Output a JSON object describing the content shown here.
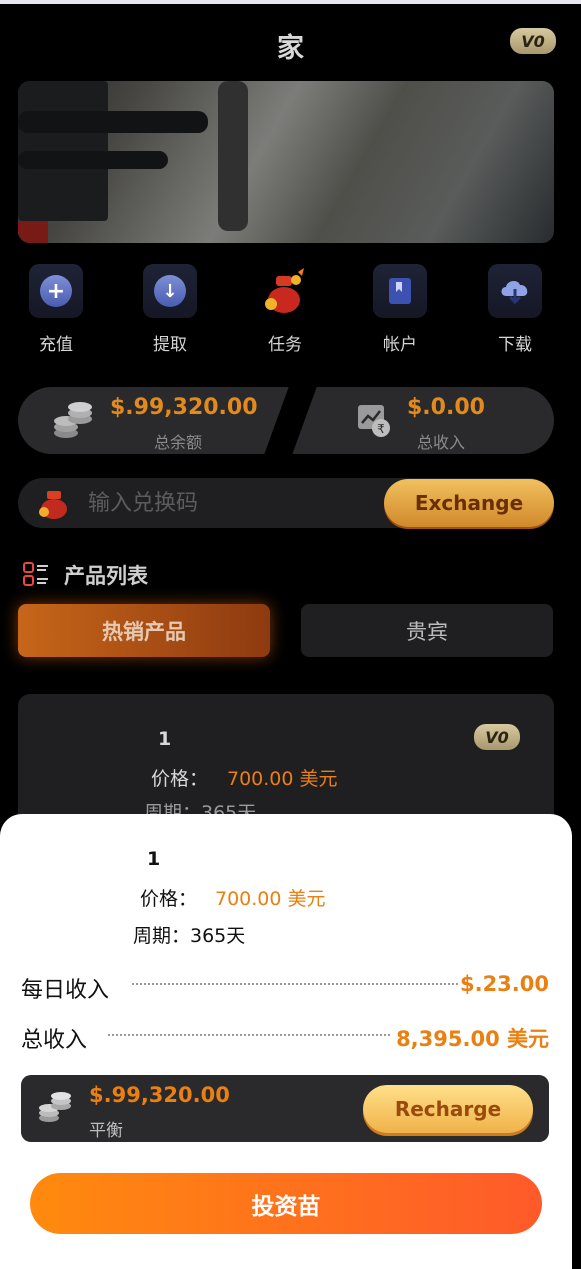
{
  "header": {
    "title": "家",
    "vip_badge": "V0"
  },
  "nav": {
    "items": [
      {
        "label": "充值",
        "icon": "plus-circle-icon"
      },
      {
        "label": "提取",
        "icon": "arrow-down-circle-icon"
      },
      {
        "label": "任务",
        "icon": "red-envelope-icon"
      },
      {
        "label": "帐户",
        "icon": "book-icon"
      },
      {
        "label": "下载",
        "icon": "cloud-download-icon"
      }
    ]
  },
  "balances": {
    "total_balance": "$.99,320.00",
    "total_balance_label": "总余额",
    "total_income": "$.0.00",
    "total_income_label": "总收入"
  },
  "redeem": {
    "placeholder": "输入兑换码",
    "button": "Exchange"
  },
  "products": {
    "section_title": "产品列表",
    "tabs": [
      "热销产品",
      "贵宾"
    ],
    "active_tab": "热销产品",
    "card": {
      "name": "1",
      "price_label": "价格：",
      "price": "700.00 美元",
      "period_partial": "周期：365天",
      "vip_badge": "V0"
    }
  },
  "sheet": {
    "name": "1",
    "price_label": "价格：",
    "price": "700.00 美元",
    "period": "周期：365天",
    "daily_income_label": "每日收入",
    "daily_income": "$.23.00",
    "total_income_label": "总收入",
    "total_income": "8,395.00 美元",
    "wallet_amount": "$.99,320.00",
    "wallet_label": "平衡",
    "recharge_button": "Recharge",
    "invest_button": "投资苗"
  },
  "colors": {
    "accent_orange": "#ea7f12",
    "button_gradient_start": "#ff8a0e",
    "button_gradient_end": "#ff5a2a"
  }
}
